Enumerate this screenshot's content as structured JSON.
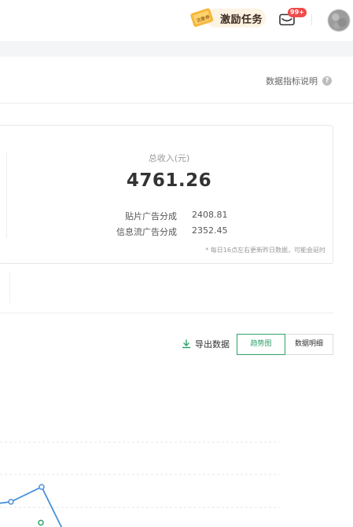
{
  "topbar": {
    "task_badge_text": "流量券",
    "task_label": "激励任务",
    "mail_badge": "99+"
  },
  "header": {
    "metric_help_label": "数据指标说明",
    "help_icon_text": "?"
  },
  "revenue_card": {
    "total_label": "总收入(元)",
    "total_value": "4761.26",
    "breakdown": [
      {
        "label": "贴片广告分成",
        "value": "2408.81"
      },
      {
        "label": "信息流广告分成",
        "value": "2352.45"
      }
    ],
    "footnote": "* 每日16点左右更新昨日数据，可能会延时"
  },
  "toolbar": {
    "export_label": "导出数据",
    "views": [
      {
        "label": "趋势图",
        "active": true
      },
      {
        "label": "数据明细",
        "active": false
      }
    ]
  },
  "colors": {
    "accent_green": "#2ea36a",
    "series_blue": "#4a90d9",
    "badge_red": "#f04a4a"
  },
  "chart_data": {
    "type": "line",
    "note": "partially visible trend chart, values unlabeled",
    "series": [
      {
        "color": "#4a90d9",
        "values": [
          0.62,
          0.71,
          1.0,
          0.0
        ]
      },
      {
        "color": "#2ea36a",
        "values": [
          0.3
        ]
      }
    ]
  }
}
